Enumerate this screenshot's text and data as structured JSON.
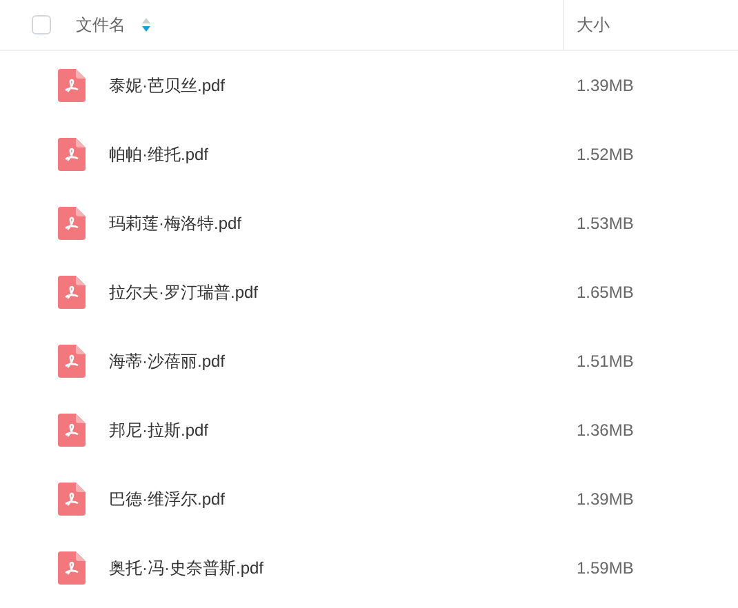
{
  "header": {
    "select_all": {
      "checked": false
    },
    "columns": [
      {
        "label": "文件名",
        "sorted": true,
        "descending": true
      },
      {
        "label": "大小"
      }
    ]
  },
  "rows": [
    {
      "name": "泰妮·芭贝丝.pdf",
      "size": "1.39MB"
    },
    {
      "name": "帕帕·维托.pdf",
      "size": "1.52MB"
    },
    {
      "name": "玛莉莲·梅洛特.pdf",
      "size": "1.53MB"
    },
    {
      "name": "拉尔夫·罗汀瑞普.pdf",
      "size": "1.65MB"
    },
    {
      "name": "海蒂·沙蓓丽.pdf",
      "size": "1.51MB"
    },
    {
      "name": "邦尼·拉斯.pdf",
      "size": "1.36MB"
    },
    {
      "name": "巴德·维浮尔.pdf",
      "size": "1.39MB"
    },
    {
      "name": "奥托·冯·史奈普斯.pdf",
      "size": "1.59MB"
    }
  ]
}
